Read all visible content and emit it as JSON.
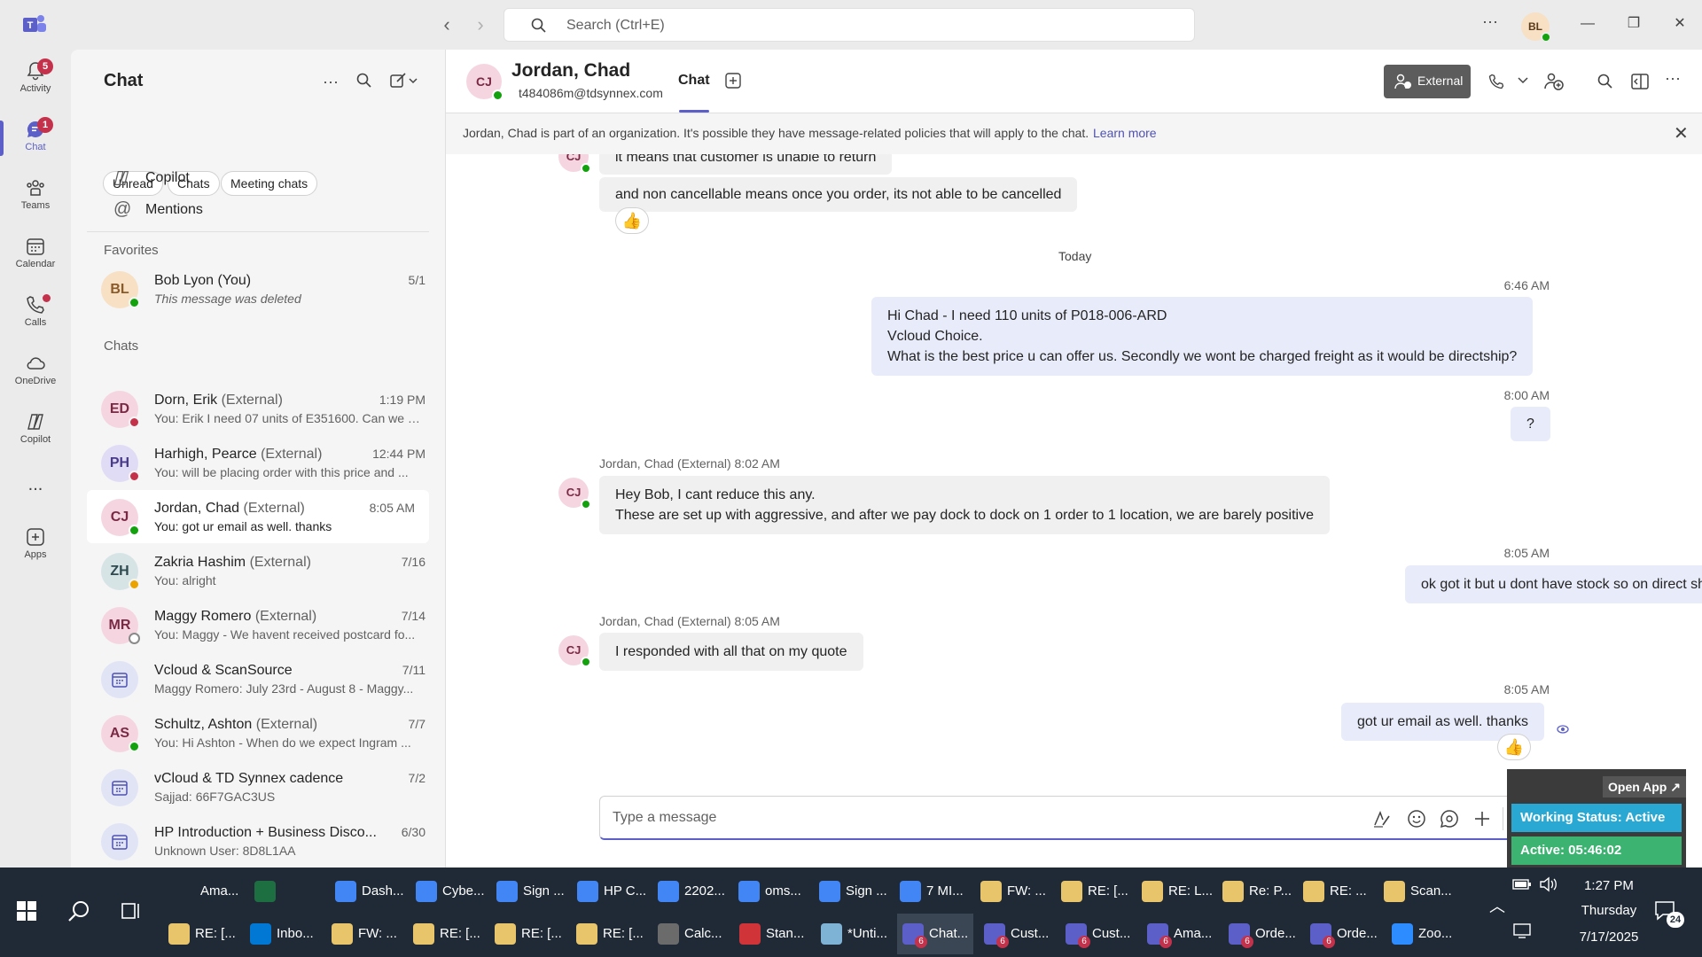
{
  "titlebar": {
    "search_placeholder": "Search (Ctrl+E)",
    "avatar": "BL"
  },
  "rail": [
    {
      "label": "Activity",
      "badge": "5",
      "icon": "bell-icon"
    },
    {
      "label": "Chat",
      "badge": "1",
      "icon": "chat-icon"
    },
    {
      "label": "Teams",
      "icon": "teams-icon"
    },
    {
      "label": "Calendar",
      "icon": "calendar-icon"
    },
    {
      "label": "Calls",
      "icon": "phone-icon"
    },
    {
      "label": "OneDrive",
      "icon": "cloud-icon"
    },
    {
      "label": "Copilot",
      "icon": "copilot-icon"
    },
    {
      "label": "...",
      "icon": "more-icon"
    },
    {
      "label": "Apps",
      "icon": "apps-icon"
    }
  ],
  "chatlist": {
    "title": "Chat",
    "filters": [
      "Unread",
      "Chats",
      "Meeting chats"
    ],
    "pinned": [
      "Copilot",
      "Mentions"
    ],
    "favorites_label": "Favorites",
    "chats_label": "Chats",
    "favorites": [
      {
        "initials": "BL",
        "name": "Bob Lyon (You)",
        "ext": "",
        "preview": "This message was deleted",
        "time": "5/1"
      }
    ],
    "chats": [
      {
        "initials": "ED",
        "name": "Dorn, Erik",
        "ext": "(External)",
        "preview": "You: Erik I need 07 units of E351600. Can we g...",
        "time": "1:19 PM"
      },
      {
        "initials": "PH",
        "name": "Harhigh, Pearce",
        "ext": "(External)",
        "preview": "You: will be placing order with this price and ...",
        "time": "12:44 PM"
      },
      {
        "initials": "CJ",
        "name": "Jordan, Chad",
        "ext": "(External)",
        "preview": "You: got ur email as well. thanks",
        "time": "8:05 AM"
      },
      {
        "initials": "ZH",
        "name": "Zakria Hashim",
        "ext": "(External)",
        "preview": "You: alright",
        "time": "7/16"
      },
      {
        "initials": "MR",
        "name": "Maggy Romero",
        "ext": "(External)",
        "preview": "You: Maggy - We havent received postcard fo...",
        "time": "7/14"
      },
      {
        "initials": "",
        "name": "Vcloud & ScanSource",
        "ext": "",
        "preview": "Maggy Romero: July 23rd - August 8 - Maggy...",
        "time": "7/11"
      },
      {
        "initials": "AS",
        "name": "Schultz, Ashton",
        "ext": "(External)",
        "preview": "You: Hi Ashton -  When do we expect Ingram ...",
        "time": "7/7"
      },
      {
        "initials": "",
        "name": "vCloud & TD Synnex cadence",
        "ext": "",
        "preview": "Sajjad: 66F7GAC3US",
        "time": "7/2"
      },
      {
        "initials": "",
        "name": "HP Introduction + Business Disco...",
        "ext": "",
        "preview": "Unknown User: 8D8L1AA",
        "time": "6/30"
      }
    ]
  },
  "header": {
    "initials": "CJ",
    "name": "Jordan, Chad",
    "email": "t484086m@tdsynnex.com",
    "tab": "Chat",
    "external": "External"
  },
  "banner": {
    "text": "Jordan, Chad is part of an organization. It's possible they have message-related policies that will apply to the chat.",
    "link": "Learn more"
  },
  "messages": {
    "m0": "it means that customer is unable to return",
    "m1": "and non cancellable means once you order, its not able to be cancelled",
    "day": "Today",
    "t1": "6:46 AM",
    "m2a": "Hi Chad -  I need 110 units of P018-006-ARD",
    "m2b": "Vcloud Choice.",
    "m2c": "What is the best price u can offer us. Secondly we wont be charged freight as it would be directship?",
    "t2": "8:00 AM",
    "m3": "?",
    "s1": "Jordan, Chad (External)  8:02 AM",
    "m4a": "Hey Bob, I cant reduce this any.",
    "m4b": "These are set up with aggressive, and after we pay dock to dock on 1 order to 1 location, we are barely positive",
    "t3": "8:05 AM",
    "m5": "ok got it but u dont have stock so on direct ship we wont be charged any freight right.",
    "s2": "Jordan, Chad (External)  8:05 AM",
    "m6": "I responded with all that on my quote",
    "t4": "8:05 AM",
    "m7": "got ur email as well. thanks"
  },
  "composer": {
    "placeholder": "Type a message"
  },
  "widget": {
    "open": "Open App ↗",
    "status": "Working Status: Active",
    "active": "Active: 05:46:02"
  },
  "taskbar": {
    "row1": [
      "Ama...",
      "",
      "Dash...",
      "Cybe...",
      "Sign ...",
      "HP C...",
      "2202...",
      "oms...",
      "Sign ...",
      "7 MI...",
      "FW: ...",
      "RE: [...",
      "RE: L...",
      "Re: P...",
      "RE: ...",
      "Scan..."
    ],
    "row2": [
      "RE: [...",
      "Inbo...",
      "FW: ...",
      "RE: [...",
      "RE: [...",
      "RE: [...",
      "Calc...",
      "Stan...",
      "*Unti...",
      "Chat...",
      "Cust...",
      "Cust...",
      "Ama...",
      "Orde...",
      "Orde...",
      "Zoo..."
    ],
    "time": "1:27 PM",
    "day": "Thursday",
    "date": "7/17/2025",
    "notif": "24"
  }
}
